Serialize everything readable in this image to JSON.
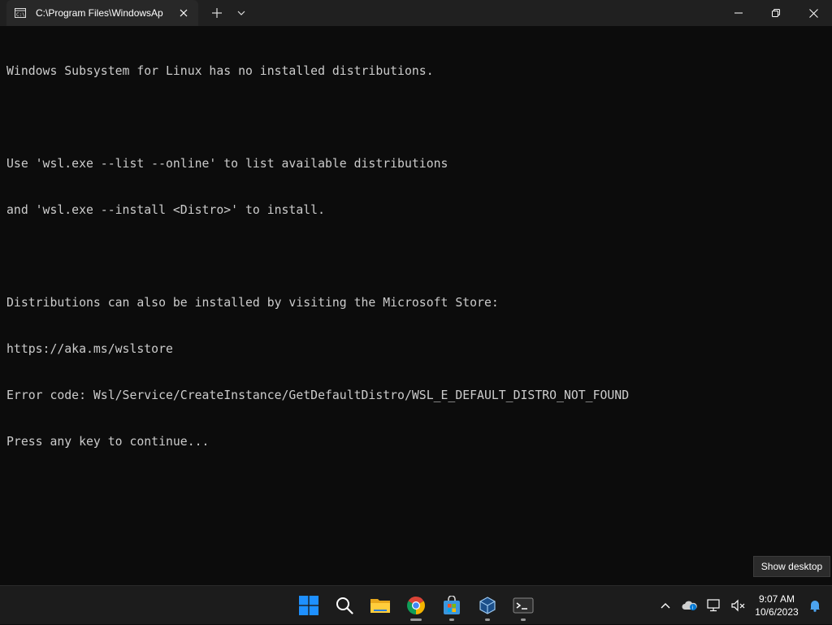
{
  "window": {
    "tab_title": "C:\\Program Files\\WindowsAp"
  },
  "terminal": {
    "lines": [
      "Windows Subsystem for Linux has no installed distributions.",
      "",
      "Use 'wsl.exe --list --online' to list available distributions",
      "and 'wsl.exe --install <Distro>' to install.",
      "",
      "Distributions can also be installed by visiting the Microsoft Store:",
      "https://aka.ms/wslstore",
      "Error code: Wsl/Service/CreateInstance/GetDefaultDistro/WSL_E_DEFAULT_DISTRO_NOT_FOUND",
      "Press any key to continue..."
    ]
  },
  "tooltip": {
    "text": "Show desktop"
  },
  "taskbar": {
    "apps": [
      {
        "icon": "windows-start-icon"
      },
      {
        "icon": "search-icon"
      },
      {
        "icon": "file-explorer-icon"
      },
      {
        "icon": "chrome-icon"
      },
      {
        "icon": "microsoft-store-icon"
      },
      {
        "icon": "virtualbox-icon"
      },
      {
        "icon": "terminal-icon"
      }
    ],
    "clock": {
      "time": "9:07 AM",
      "date": "10/6/2023"
    }
  },
  "colors": {
    "terminal_bg": "#0c0c0c",
    "terminal_fg": "#cccccc",
    "titlebar_bg": "#202020",
    "taskbar_bg": "#1c1c1c",
    "accent": "#0078d4"
  }
}
